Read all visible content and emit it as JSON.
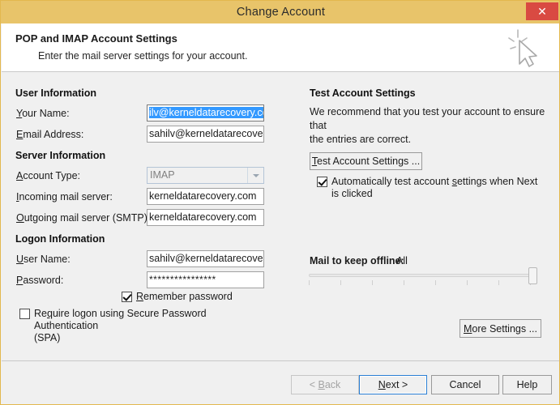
{
  "window": {
    "title": "Change Account",
    "close_label": "✕",
    "close_icon": "close-icon"
  },
  "header": {
    "title": "POP and IMAP Account Settings",
    "subtitle": "Enter the mail server settings for your account.",
    "icon": "cursor-sparkle-icon"
  },
  "left": {
    "user_information_heading": "User Information",
    "your_name_label": "Your Name:",
    "your_name_accel": "Y",
    "your_name_value": "ilv@kerneldatarecovery.com",
    "email_label": "Email Address:",
    "email_accel": "E",
    "email_value": "sahilv@kerneldatarecovery.c",
    "server_information_heading": "Server Information",
    "account_type_label": "Account Type:",
    "account_type_accel": "A",
    "account_type_value": "IMAP",
    "incoming_label": "Incoming mail server:",
    "incoming_accel": "I",
    "incoming_value": "kerneldatarecovery.com",
    "outgoing_label": "Outgoing mail server (SMTP):",
    "outgoing_accel": "O",
    "outgoing_value": "kerneldatarecovery.com",
    "logon_information_heading": "Logon Information",
    "username_label": "User Name:",
    "username_accel": "U",
    "username_value": "sahilv@kerneldatarecovery.c",
    "password_label": "Password:",
    "password_accel": "P",
    "password_value": "****************",
    "remember_password_label": "Remember password",
    "remember_password_accel": "R",
    "remember_password_checked": true,
    "spa_label_line1": "Require logon using Secure Password Authentication",
    "spa_label_line2": "(SPA)",
    "spa_accel": "g",
    "spa_checked": false
  },
  "right": {
    "test_heading": "Test Account Settings",
    "test_para_line1": "We recommend that you test your account to ensure that",
    "test_para_line2": "the entries are correct.",
    "test_button_label": "Test Account Settings ...",
    "test_button_accel": "T",
    "auto_test_line1": "Automatically test account settings when Next",
    "auto_test_line2": "is clicked",
    "auto_test_accel": "s",
    "auto_test_checked": true,
    "mail_offline_label": "Mail to keep offline:",
    "mail_offline_value": "All",
    "slider_ticks": 8,
    "slider_position_percent": 100,
    "more_settings_label": "More Settings ...",
    "more_settings_accel": "M"
  },
  "footer": {
    "back_label": "< Back",
    "back_accel": "B",
    "back_disabled": true,
    "next_label": "Next >",
    "next_accel": "N",
    "next_is_default": true,
    "cancel_label": "Cancel",
    "help_label": "Help"
  },
  "colors": {
    "titlebar": "#e8c46a",
    "close_button": "#d94a42",
    "body": "#f0f0f0",
    "selection": "#3399ff",
    "default_button_border": "#2a7fd4"
  }
}
